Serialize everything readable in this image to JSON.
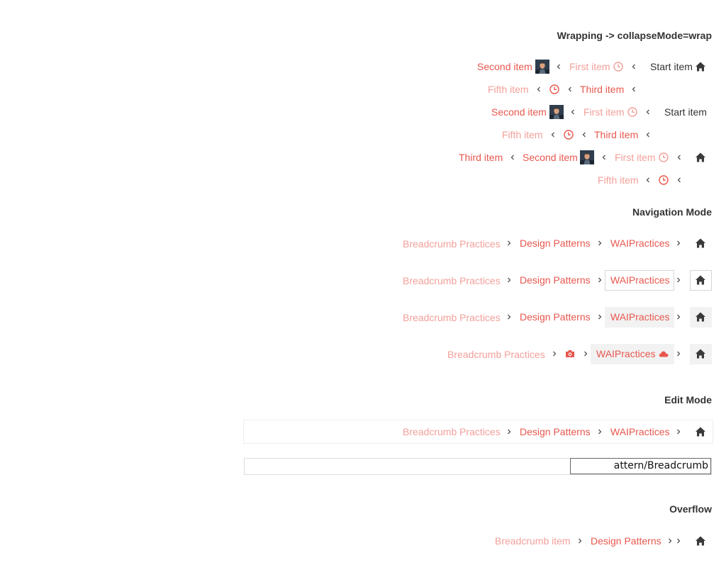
{
  "colors": {
    "accent": "#e8574e",
    "accent_light": "#f2a09a",
    "text": "#333333"
  },
  "sections": {
    "wrapping": {
      "title": "Wrapping -> collapseMode=wrap"
    },
    "navigation": {
      "title": "Navigation Mode"
    },
    "edit": {
      "title": "Edit Mode"
    },
    "overflow": {
      "title": "Overflow"
    }
  },
  "wrap_rows": {
    "r1": {
      "second": "Second item",
      "first": "First item",
      "start": "Start item"
    },
    "r2": {
      "fifth": "Fifth item",
      "third": "Third item"
    },
    "r3": {
      "second": "Second item",
      "first": "First item",
      "start": "Start item"
    },
    "r4": {
      "fifth": "Fifth item",
      "third": "Third item"
    },
    "r5": {
      "third": "Third item",
      "second": "Second item",
      "first": "First item"
    },
    "r6": {
      "fifth": "Fifth item"
    }
  },
  "nav_rows": {
    "n1": {
      "a": "Breadcrumb Practices",
      "b": "Design Patterns",
      "c": "WAIPractices"
    },
    "n2": {
      "a": "Breadcrumb Practices",
      "b": "Design Patterns",
      "c": "WAIPractices"
    },
    "n3": {
      "a": "Breadcrumb Practices",
      "b": "Design Patterns",
      "c": "WAIPractices"
    },
    "n4": {
      "a": "Breadcrumb Practices",
      "c": "WAIPractices"
    }
  },
  "edit_rows": {
    "e1": {
      "a": "Breadcrumb Practices",
      "b": "Design Patterns",
      "c": "WAIPractices"
    },
    "e2": {
      "input_value": "attern/Breadcrumb Practices"
    }
  },
  "overflow_row": {
    "a": "Breadcrumb item",
    "b": "Design Patterns"
  },
  "icons": [
    "home-icon",
    "clock-icon",
    "avatar-image",
    "chevron-left-icon",
    "chevron-right-icon",
    "camera-icon",
    "cloud-icon"
  ]
}
